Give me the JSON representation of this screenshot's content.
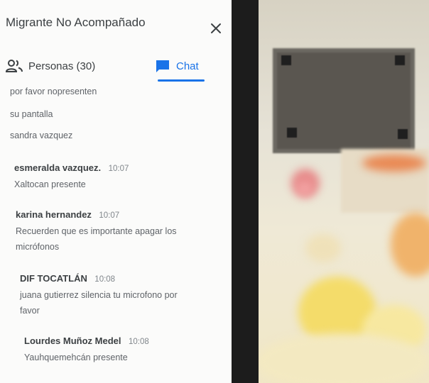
{
  "header": {
    "title": "Migrante No Acompañado",
    "close_icon": "close-icon"
  },
  "tabs": {
    "people": {
      "label": "Personas (30)",
      "icon": "people-icon"
    },
    "chat": {
      "label": "Chat",
      "icon": "chat-icon",
      "active": true
    }
  },
  "chat": {
    "continuation_lines": [
      "por favor nopresenten",
      "su pantalla",
      "sandra vazquez"
    ],
    "messages": [
      {
        "sender": "esmeralda vazquez.",
        "time": "10:07",
        "lines": [
          "Xaltocan presente"
        ]
      },
      {
        "sender": "karina hernandez",
        "time": "10:07",
        "lines": [
          "Recuerden que es importante apagar los",
          "micrófonos"
        ]
      },
      {
        "sender": "DIF TOCATLÁN",
        "time": "10:08",
        "lines": [
          "juana gutierrez silencia tu microfono por",
          "favor"
        ]
      },
      {
        "sender": "Lourdes Muñoz Medel",
        "time": "10:08",
        "lines": [
          "Yauhquemehcán presente"
        ]
      }
    ]
  },
  "colors": {
    "accent": "#1a73e8",
    "panel_bg": "#fbfbfa",
    "text_primary": "#3c4043",
    "text_secondary": "#5f6368"
  }
}
